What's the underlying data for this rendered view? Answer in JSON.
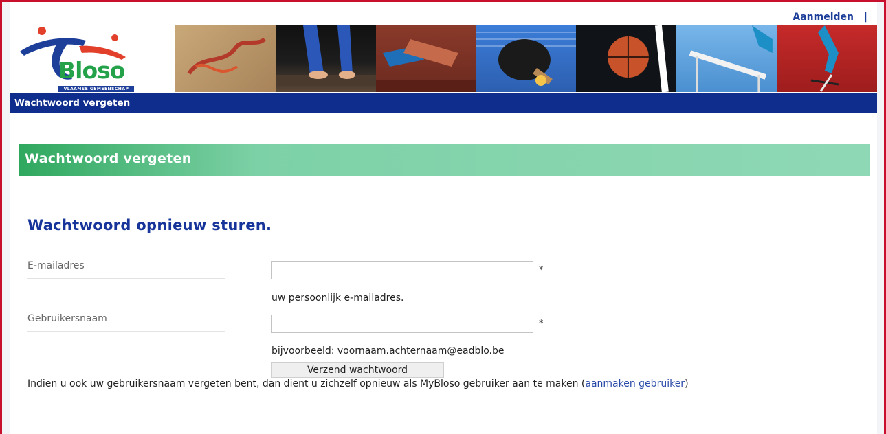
{
  "top_links": {
    "login": "Aanmelden",
    "separator": "|"
  },
  "logo": {
    "name": "Bloso",
    "subtitle": "Vlaamse Gemeenschap"
  },
  "navbar": {
    "breadcrumb": "Wachtwoord vergeten"
  },
  "section": {
    "title": "Wachtwoord vergeten"
  },
  "form": {
    "title": "Wachtwoord opnieuw sturen.",
    "email": {
      "label": "E-mailadres",
      "value": "",
      "required": "*",
      "hint": "uw persoonlijk e-mailadres."
    },
    "username": {
      "label": "Gebruikersnaam",
      "value": "",
      "required": "*",
      "hint": "bijvoorbeeld: voornaam.achternaam@eadblo.be"
    },
    "submit_label": "Verzend wachtwoord"
  },
  "note": {
    "text_before": "Indien u ook uw gebruikersnaam vergeten bent, dan dient u zichzelf opnieuw als MyBloso gebruiker aan te maken (",
    "link": "aanmaken gebruiker",
    "text_after": ")"
  },
  "colors": {
    "frame": "#c8102e",
    "navbar": "#0f2d8c",
    "section_green": "#2fa85f",
    "title_blue": "#17349a",
    "link": "#2a4aa8"
  }
}
